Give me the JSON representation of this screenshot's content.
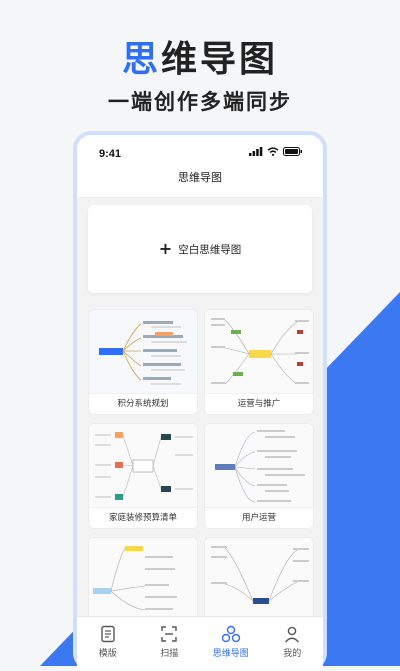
{
  "hero": {
    "title_part1": "思",
    "title_part2": "维导图",
    "subtitle": "一端创作多端同步"
  },
  "colors": {
    "accent": "#2f6ef5",
    "background_triangle": "#3b78f2"
  },
  "phone": {
    "status_time": "9:41",
    "nav_title": "思维导图",
    "blank_card_label": "空白思维导图",
    "templates": [
      {
        "label": "积分系统规划"
      },
      {
        "label": "运营与推广"
      },
      {
        "label": "家庭装修预算清单"
      },
      {
        "label": "用户运营"
      },
      {
        "label": ""
      },
      {
        "label": ""
      }
    ],
    "tabs": [
      {
        "label": "模版",
        "icon": "template-icon",
        "active": false
      },
      {
        "label": "扫描",
        "icon": "scan-icon",
        "active": false
      },
      {
        "label": "思维导图",
        "icon": "mindmap-icon",
        "active": true
      },
      {
        "label": "我的",
        "icon": "user-icon",
        "active": false
      }
    ]
  }
}
